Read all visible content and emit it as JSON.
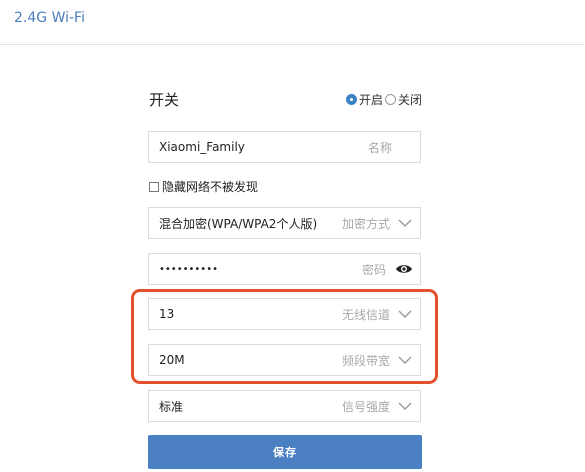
{
  "section": {
    "title": "2.4G Wi-Fi"
  },
  "switch": {
    "label": "开关",
    "options": [
      {
        "label": "开启",
        "selected": true
      },
      {
        "label": "关闭",
        "selected": false
      }
    ]
  },
  "fields": {
    "ssid": {
      "value": "Xiaomi_Family",
      "label": "名称"
    },
    "hidden": {
      "label": "隐藏网络不被发现",
      "checked": false
    },
    "encryption": {
      "value": "混合加密(WPA/WPA2个人版)",
      "label": "加密方式",
      "icon": "chevron-down-icon"
    },
    "password": {
      "value": "••••••••••",
      "label": "密码",
      "icon": "eye-icon"
    },
    "channel": {
      "value": "13",
      "label": "无线信道",
      "icon": "chevron-down-icon"
    },
    "bandwidth": {
      "value": "20M",
      "label": "频段带宽",
      "icon": "chevron-down-icon"
    },
    "signal": {
      "value": "标准",
      "label": "信号强度",
      "icon": "chevron-down-icon"
    }
  },
  "save": {
    "label": "保存"
  },
  "colors": {
    "accent": "#4a7fc1",
    "highlight_box": "#e2512b",
    "title": "#4a7fbd"
  }
}
